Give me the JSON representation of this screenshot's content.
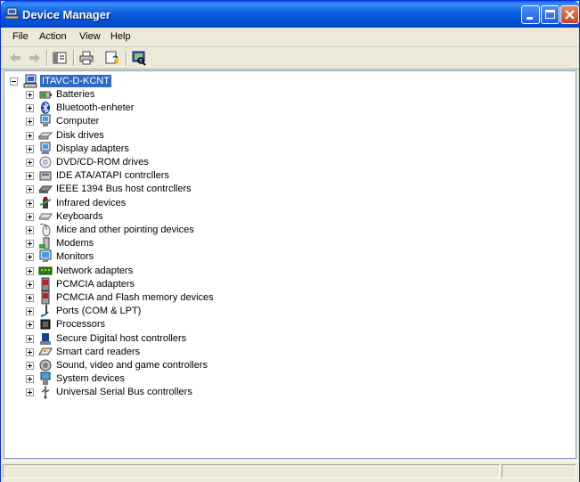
{
  "window": {
    "title": "Device Manager"
  },
  "menu": [
    "File",
    "Action",
    "View",
    "Help"
  ],
  "toolbar": [
    "back-icon",
    "forward-icon",
    "properties-pane-icon",
    "print-icon",
    "help-icon",
    "scan-hardware-icon"
  ],
  "tree": {
    "root": "ITAVC-D-KCNT",
    "items": [
      {
        "label": "Batteries",
        "icon": "battery-icon"
      },
      {
        "label": "Bluetooth-enheter",
        "icon": "bluetooth-icon"
      },
      {
        "label": "Computer",
        "icon": "computer-icon"
      },
      {
        "label": "Disk drives",
        "icon": "disk-drive-icon"
      },
      {
        "label": "Display adapters",
        "icon": "display-adapter-icon"
      },
      {
        "label": "DVD/CD-ROM drives",
        "icon": "dvd-icon"
      },
      {
        "label": "IDE ATA/ATAPI contrcllers",
        "icon": "ide-controller-icon"
      },
      {
        "label": "IEEE 1394 Bus host contrcllers",
        "icon": "firewire-icon"
      },
      {
        "label": "Infrared devices",
        "icon": "infrared-icon"
      },
      {
        "label": "Keyboards",
        "icon": "keyboard-icon"
      },
      {
        "label": "Mice and other pointing devices",
        "icon": "mouse-icon"
      },
      {
        "label": "Modems",
        "icon": "modem-icon"
      },
      {
        "label": "Monitors",
        "icon": "monitor-icon"
      },
      {
        "label": "Network adapters",
        "icon": "network-adapter-icon"
      },
      {
        "label": "PCMCIA adapters",
        "icon": "pcmcia-icon"
      },
      {
        "label": "PCMCIA and Flash memory devices",
        "icon": "flash-memory-icon"
      },
      {
        "label": "Ports (COM & LPT)",
        "icon": "port-icon"
      },
      {
        "label": "Processors",
        "icon": "processor-icon"
      },
      {
        "label": "Secure Digital host controllers",
        "icon": "sd-controller-icon"
      },
      {
        "label": "Smart card readers",
        "icon": "smart-card-icon"
      },
      {
        "label": "Sound, video and game controllers",
        "icon": "sound-icon"
      },
      {
        "label": "System devices",
        "icon": "system-device-icon"
      },
      {
        "label": "Universal Serial Bus controllers",
        "icon": "usb-icon"
      }
    ]
  },
  "colors": {
    "titlebar": "#0a5fd8",
    "selection": "#316ac5",
    "tree_bg": "#ffffff",
    "chrome": "#ece9d8"
  }
}
